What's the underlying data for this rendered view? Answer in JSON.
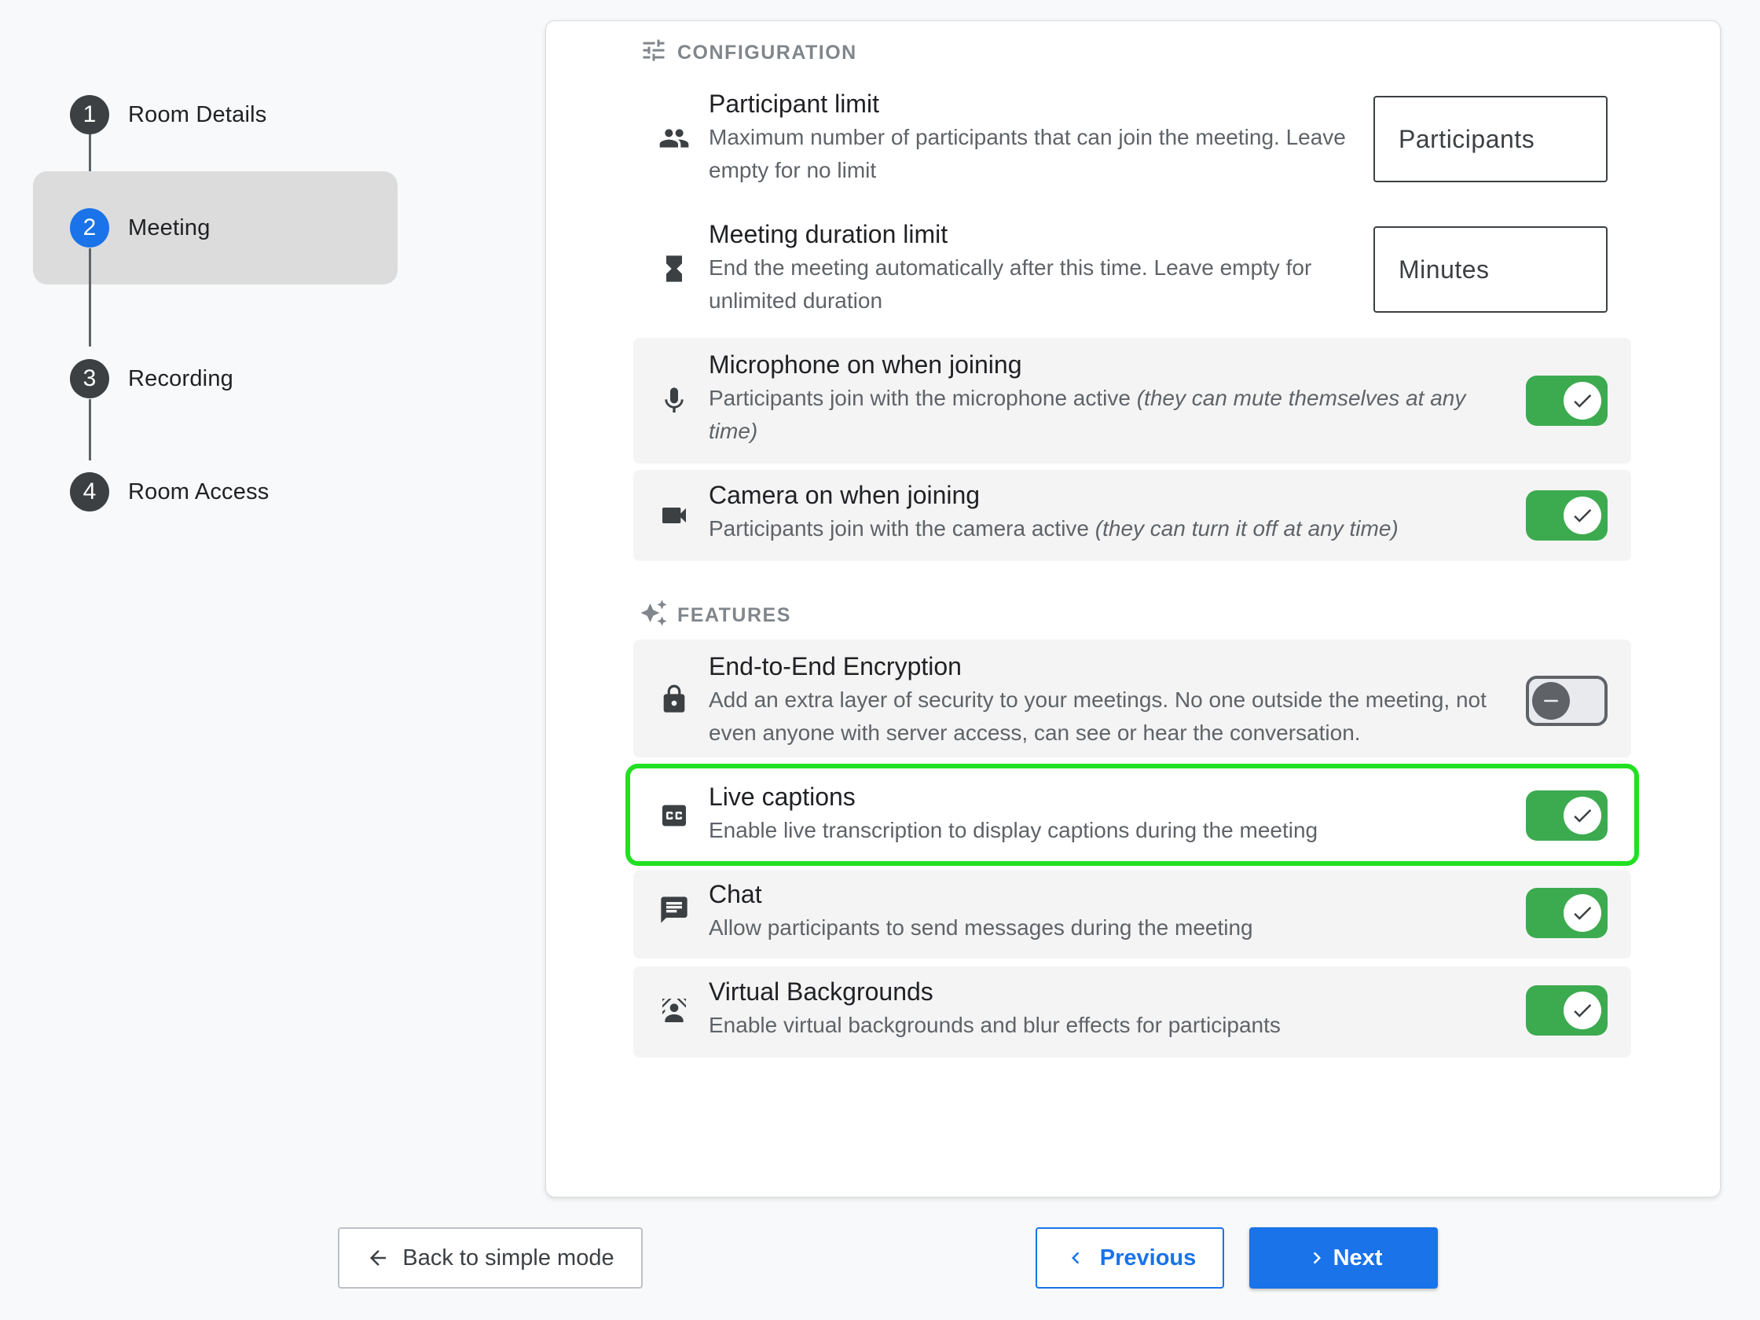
{
  "stepper": {
    "steps": [
      {
        "number": "1",
        "label": "Room Details"
      },
      {
        "number": "2",
        "label": "Meeting"
      },
      {
        "number": "3",
        "label": "Recording"
      },
      {
        "number": "4",
        "label": "Room Access"
      }
    ],
    "active_step": 2
  },
  "configuration": {
    "header": "CONFIGURATION",
    "participant_limit": {
      "title": "Participant limit",
      "description": "Maximum number of participants that can join the meeting. Leave empty for no limit",
      "placeholder": "Participants",
      "value": ""
    },
    "duration_limit": {
      "title": "Meeting duration limit",
      "description": "End the meeting automatically after this time. Leave empty for unlimited duration",
      "placeholder": "Minutes",
      "value": ""
    },
    "microphone": {
      "title": "Microphone on when joining",
      "description": "Participants join with the microphone active ",
      "description_note": "(they can mute themselves at any time)",
      "enabled": true
    },
    "camera": {
      "title": "Camera on when joining",
      "description": "Participants join with the camera active ",
      "description_note": "(they can turn it off at any time)",
      "enabled": true
    }
  },
  "features": {
    "header": "FEATURES",
    "encryption": {
      "title": "End-to-End Encryption",
      "description": "Add an extra layer of security to your meetings. No one outside the meeting, not even anyone with server access, can see or hear the conversation.",
      "enabled": false
    },
    "live_captions": {
      "title": "Live captions",
      "description": "Enable live transcription to display captions during the meeting",
      "enabled": true
    },
    "chat": {
      "title": "Chat",
      "description": "Allow participants to send messages during the meeting",
      "enabled": true
    },
    "virtual_backgrounds": {
      "title": "Virtual Backgrounds",
      "description": "Enable virtual backgrounds and blur effects for participants",
      "enabled": true
    }
  },
  "footer": {
    "back_label": "Back to simple mode",
    "previous_label": "Previous",
    "next_label": "Next"
  },
  "colors": {
    "accent": "#1a73e8",
    "toggle_on": "#3cab4f",
    "highlight": "#21e021"
  }
}
